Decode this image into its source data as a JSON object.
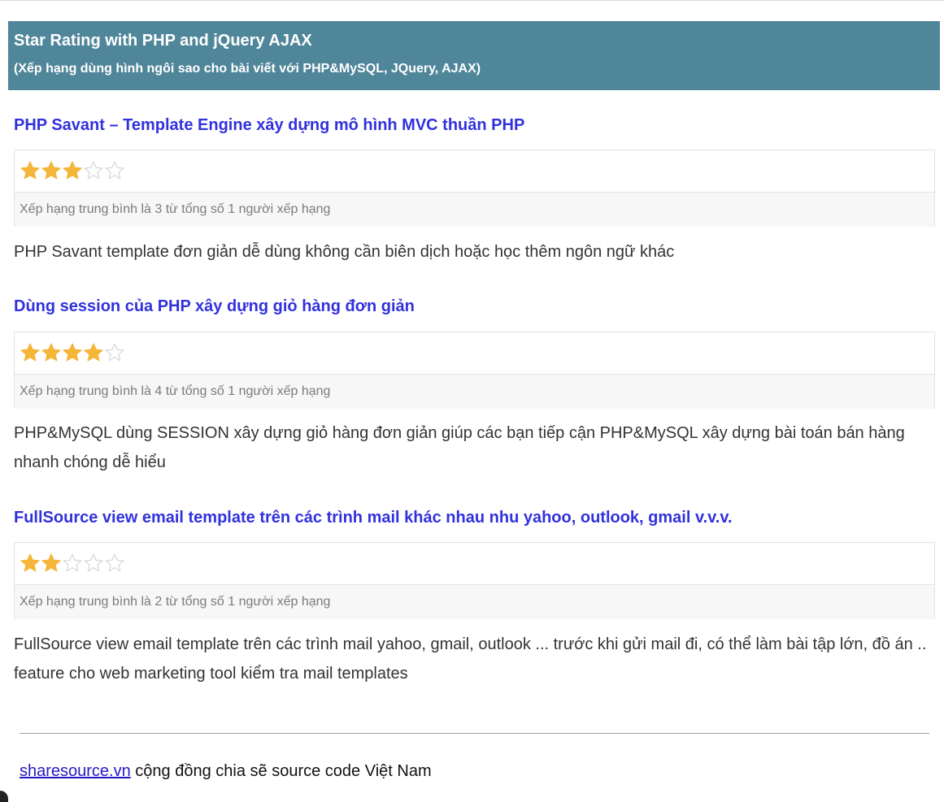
{
  "header": {
    "title": "Star Rating with PHP and jQuery AJAX",
    "subtitle": "(Xếp hạng dùng hình ngôi sao cho bài viết với PHP&MySQL, JQuery, AJAX)"
  },
  "colors": {
    "header_bg": "#50869a",
    "title_link": "#3131de",
    "star_filled": "#f5b538",
    "star_empty": "#e6e6e6"
  },
  "articles": [
    {
      "title": "PHP Savant – Template Engine xây dựng mô hình MVC thuần PHP",
      "rating": 3,
      "max_rating": 5,
      "rating_text": "Xếp hạng trung bình là 3 từ tổng số 1 người xếp hạng",
      "description": "PHP Savant template đơn giản dễ dùng không cần biên dịch hoặc học thêm ngôn ngữ khác"
    },
    {
      "title": "Dùng session của PHP xây dựng giỏ hàng đơn giản",
      "rating": 4,
      "max_rating": 5,
      "rating_text": "Xếp hạng trung bình là 4 từ tổng số 1 người xếp hạng",
      "description": "PHP&MySQL dùng SESSION xây dựng giỏ hàng đơn giản giúp các bạn tiếp cận PHP&MySQL xây dựng bài toán bán hàng nhanh chóng dễ hiểu"
    },
    {
      "title": "FullSource view email template trên các trình mail khác nhau nhu yahoo, outlook, gmail v.v.v.",
      "rating": 2,
      "max_rating": 5,
      "rating_text": "Xếp hạng trung bình là 2 từ tổng số 1 người xếp hạng",
      "description": "FullSource view email template trên các trình mail yahoo, gmail, outlook ... trước khi gửi mail đi, có thể làm bài tập lớn, đồ án .. feature cho web marketing tool kiểm tra mail templates"
    }
  ],
  "footer": {
    "link_text": "sharesource.vn",
    "text": " cộng đồng chia sẽ source code Việt Nam"
  }
}
